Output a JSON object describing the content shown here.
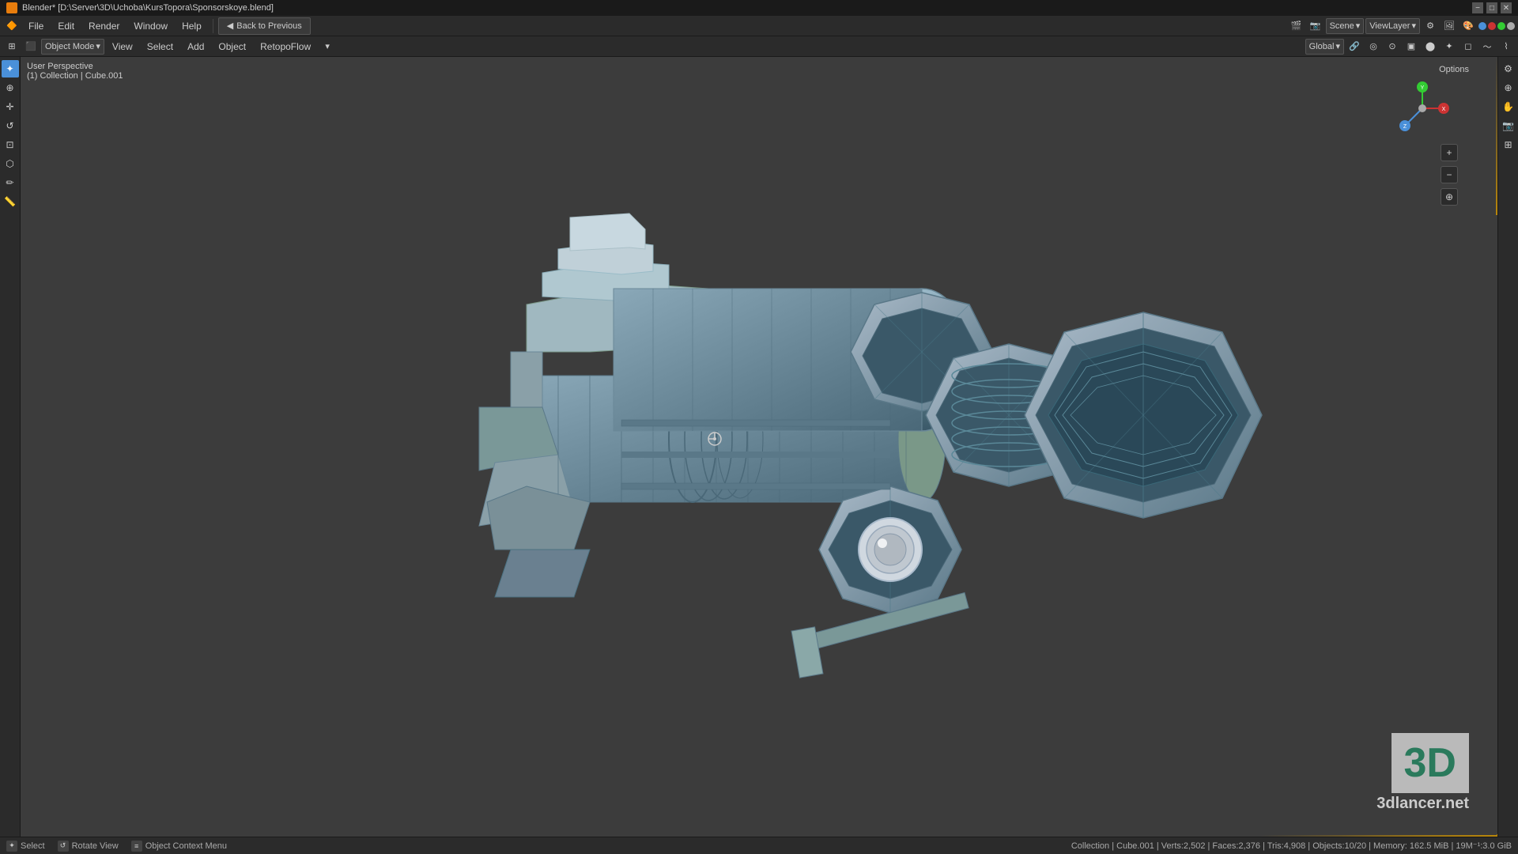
{
  "titlebar": {
    "icon": "blender-icon",
    "title": "Blender* [D:\\Server\\3D\\Uchoba\\KursTopora\\Sponsorskoye.blend]",
    "minimize": "−",
    "maximize": "□",
    "close": "✕"
  },
  "menubar": {
    "scene_label": "Scene",
    "view_layer_label": "ViewLayer",
    "back_btn": "Back to Previous",
    "menus": [
      "File",
      "Edit",
      "Render",
      "Window",
      "Help"
    ]
  },
  "viewport_header": {
    "mode": "Object Mode",
    "view": "View",
    "select": "Select",
    "add": "Add",
    "object": "Object",
    "retopoflow": "RetopoFlow",
    "global": "Global"
  },
  "viewport_info": {
    "perspective": "User Perspective",
    "collection": "(1) Collection | Cube.001"
  },
  "options_label": "Options",
  "right_icons": {
    "cursor": "⊕",
    "hand": "✋",
    "camera": "📷",
    "layers": "⊞"
  },
  "status_bar": {
    "select": "Select",
    "rotate_view": "Rotate View",
    "context_menu": "Object Context Menu",
    "stats": "Collection | Cube.001 | Verts:2,502 | Faces:2,376 | Tris:4,908 | Objects:10/20 | Memory: 162.5 MiB | 19M⁻¹:3.0 GiB"
  },
  "watermark": {
    "big_text": "3D",
    "small_text": "3dlancer.net"
  },
  "colors": {
    "dot_blue": "#4a90d9",
    "dot_red": "#cc3333",
    "dot_green": "#33cc33",
    "dot_white": "#aaaaaa",
    "accent": "#e87d0d"
  }
}
